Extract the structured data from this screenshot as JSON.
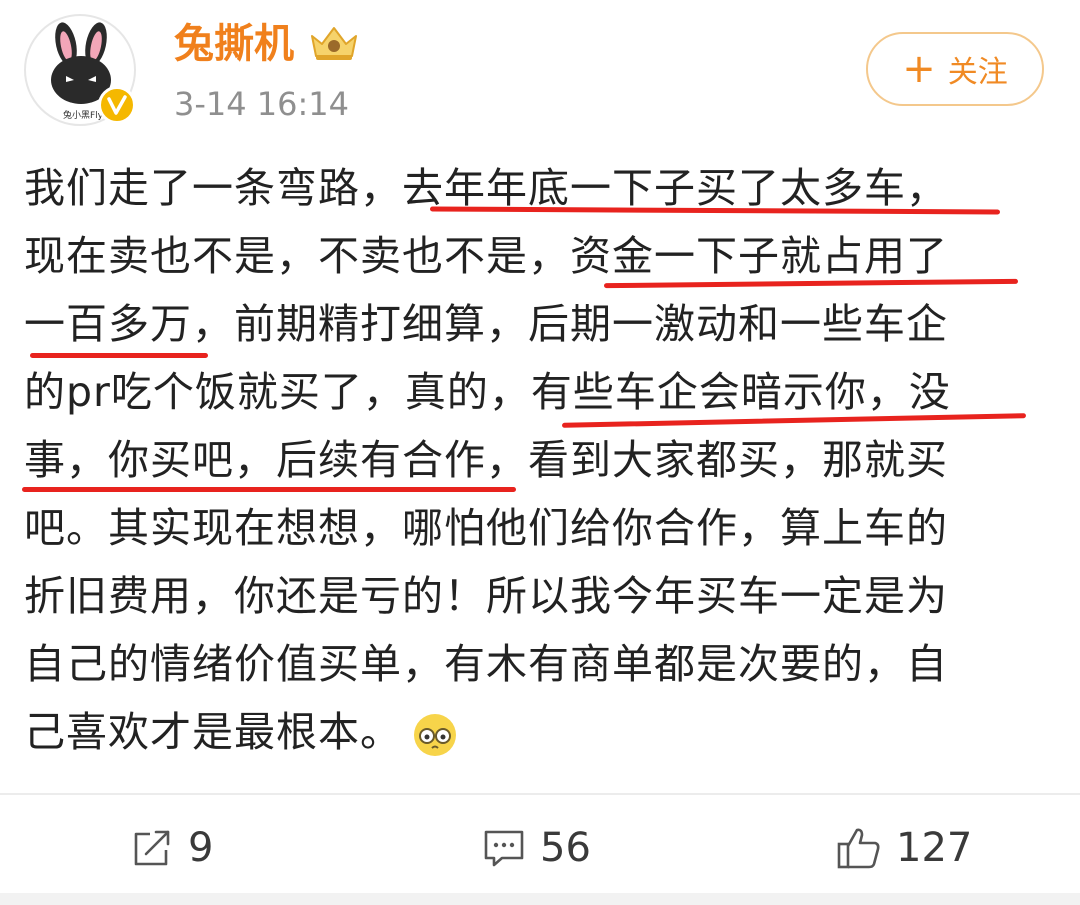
{
  "post": {
    "username": "兔撕机",
    "avatar_caption": "兔小黑Fly",
    "timestamp": "3-14 16:14",
    "follow_label": "关注",
    "follow_plus": "+",
    "lines": [
      "我们走了一条弯路，去年年底一下子买了太多车，",
      "现在卖也不是，不卖也不是，资金一下子就占用了",
      "一百多万，前期精打细算，后期一激动和一些车企",
      "的pr吃个饭就买了，真的，有些车企会暗示你，没",
      "事，你买吧，后续有合作，看到大家都买，那就买",
      "吧。其实现在想想，哪怕他们给你合作，算上车的",
      "折旧费用，你还是亏的！所以我今年买车一定是为",
      "自己的情绪价值买单，有木有商单都是次要的，自",
      "己喜欢才是最根本。"
    ]
  },
  "actions": {
    "repost_count": "9",
    "comment_count": "56",
    "like_count": "127"
  },
  "colors": {
    "username": "#f0801c",
    "follow": "#f08a24",
    "underline": "#e8231e",
    "badge": "#f5b800"
  },
  "icons": [
    "rabbit-avatar-icon",
    "verified-badge-icon",
    "crown-icon",
    "plus-icon",
    "emoji-icon",
    "repost-icon",
    "comment-icon",
    "like-icon"
  ]
}
